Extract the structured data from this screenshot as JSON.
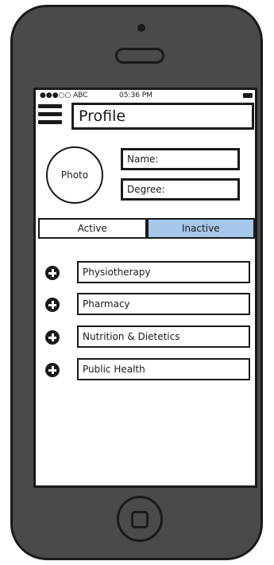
{
  "status_bar": {
    "carrier": "●●●○○ ABC",
    "time": "05:36 PM"
  },
  "header": {
    "title": "Profile"
  },
  "profile": {
    "photo_label": "Photo",
    "name_label": "Name:",
    "degree_label": "Degree:"
  },
  "segmented_control": {
    "active_label": "Active",
    "inactive_label": "Inactive",
    "selected": "Inactive",
    "selected_color": "#a6c6ea"
  },
  "list": {
    "items": [
      {
        "label": "Physiotherapy",
        "icon": "plus-circle-icon"
      },
      {
        "label": "Pharmacy",
        "icon": "plus-circle-icon"
      },
      {
        "label": "Nutrition & Dietetics",
        "icon": "plus-circle-icon"
      },
      {
        "label": "Public Health",
        "icon": "plus-circle-icon"
      }
    ]
  },
  "colors": {
    "phone_body": "#4a4a4a",
    "outline": "#1a1a1a",
    "screen_bg": "#ffffff"
  }
}
